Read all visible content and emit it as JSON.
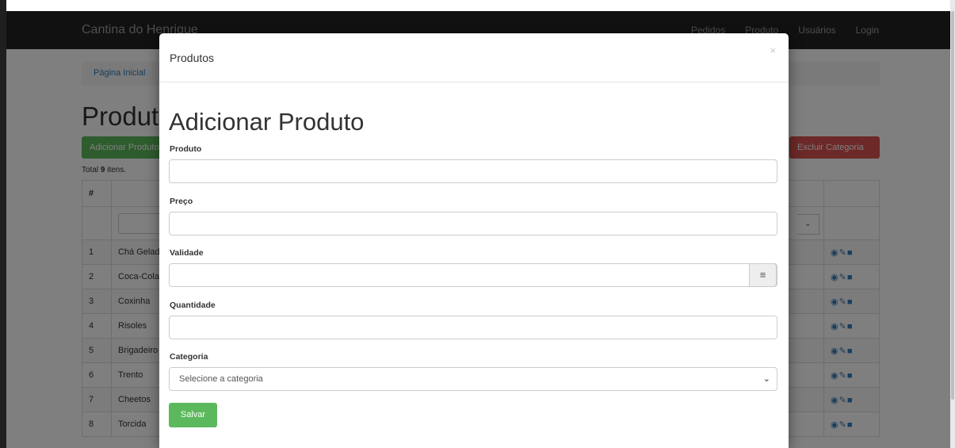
{
  "navbar": {
    "brand": "Cantina do Henrique",
    "links": [
      "Pedidos",
      "Produto",
      "Usuários",
      "Login"
    ]
  },
  "breadcrumb": {
    "home": "Página Inicial"
  },
  "page": {
    "title": "Produtos",
    "add_button": "Adicionar Produto",
    "delete_category_button": "Excluir Categoria",
    "summary_prefix": "Total ",
    "summary_count": "9",
    "summary_suffix": " itens."
  },
  "table": {
    "header_index": "#",
    "rows": [
      {
        "id": "1",
        "name": "Chá Gelado"
      },
      {
        "id": "2",
        "name": "Coca-Cola"
      },
      {
        "id": "3",
        "name": "Coxinha"
      },
      {
        "id": "4",
        "name": "Risoles"
      },
      {
        "id": "5",
        "name": "Brigadeiro"
      },
      {
        "id": "6",
        "name": "Trento"
      },
      {
        "id": "7",
        "name": "Cheetos"
      },
      {
        "id": "8",
        "name": "Torcida"
      }
    ]
  },
  "modal": {
    "title": "Produtos",
    "close_glyph": "×",
    "heading": "Adicionar Produto",
    "fields": {
      "produto": "Produto",
      "preco": "Preço",
      "validade": "Validade",
      "quantidade": "Quantidade",
      "categoria": "Categoria"
    },
    "category_placeholder": "Selecione a categoria",
    "save_button": "Salvar"
  },
  "icons": {
    "calendar": "calendar-icon",
    "view": "eye-icon",
    "edit": "pencil-icon",
    "delete": "trash-icon"
  },
  "colors": {
    "navbar": "#222222",
    "success": "#5cb85c",
    "danger": "#d9534f",
    "link": "#337ab7"
  }
}
